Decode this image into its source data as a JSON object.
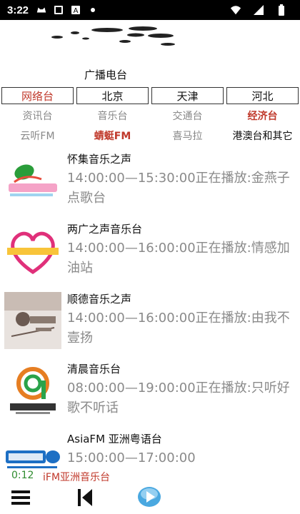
{
  "status_bar": {
    "time": "3:22",
    "icons": [
      "cat-icon",
      "card-icon",
      "a-icon",
      "dot-icon",
      "wifi-icon",
      "signal-icon",
      "battery-icon"
    ]
  },
  "header": {
    "title": "广播电台"
  },
  "region_tabs": [
    {
      "label": "网络台",
      "active": true
    },
    {
      "label": "北京",
      "active": false
    },
    {
      "label": "天津",
      "active": false
    },
    {
      "label": "河北",
      "active": false
    }
  ],
  "category_row1": [
    {
      "label": "资讯台"
    },
    {
      "label": "音乐台"
    },
    {
      "label": "交通台"
    },
    {
      "label": "经济台",
      "active": true
    }
  ],
  "category_row2": [
    {
      "label": "云听FM"
    },
    {
      "label": "蜻蜓FM",
      "active": true
    },
    {
      "label": "喜马拉"
    },
    {
      "label": "港澳台和其它"
    }
  ],
  "stations": [
    {
      "name": "怀集音乐之声",
      "info": "14:00:00—15:30:00正在播放:金燕子点歌台",
      "logo": "huaiji-logo"
    },
    {
      "name": "两广之声音乐台",
      "info": "14:00:00—16:00:00正在播放:情感加油站",
      "logo": "lianguang-logo"
    },
    {
      "name": "顺德音乐之声",
      "info": "14:00:00—16:00:00正在播放:由我不壹扬",
      "logo": "shunde-logo"
    },
    {
      "name": "清晨音乐台",
      "info": "08:00:00—19:00:00正在播放:只听好歌不听话",
      "logo": "qingchen-logo"
    },
    {
      "name": "AsiaFM 亚洲粤语台",
      "info": "15:00:00—17:00:00",
      "logo": "asiafm-logo"
    }
  ],
  "player": {
    "elapsed": "0:12",
    "now_playing": "iFM亚洲音乐台"
  },
  "colors": {
    "accent_red": "#c0392b",
    "elapsed_green": "#2e8b2e",
    "play_blue": "#4aa8e0"
  }
}
